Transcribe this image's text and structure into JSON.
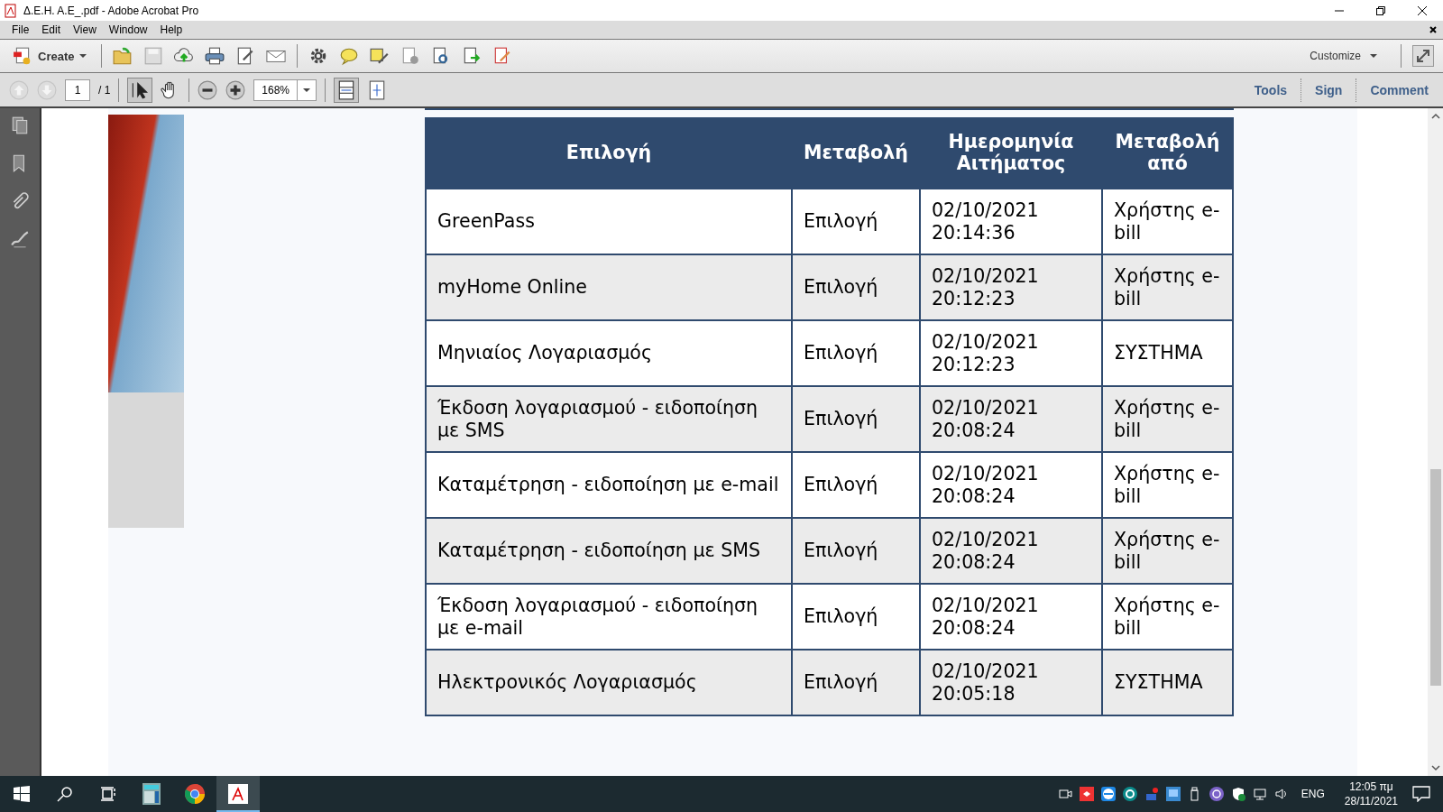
{
  "window": {
    "title": "Δ.Ε.Η. Α.Ε_.pdf - Adobe Acrobat Pro"
  },
  "menu": [
    "File",
    "Edit",
    "View",
    "Window",
    "Help"
  ],
  "toolbar": {
    "create": "Create",
    "customize": "Customize"
  },
  "navigation": {
    "page": "1",
    "page_count": "/ 1",
    "zoom": "168%"
  },
  "panel_tabs": [
    "Tools",
    "Sign",
    "Comment"
  ],
  "table": {
    "columns": [
      "Επιλογή",
      "Μεταβολή",
      "Ημερομηνία Αιτήματος",
      "Μεταβολή από"
    ],
    "rows": [
      [
        "GreenPass",
        "Επιλογή",
        "02/10/2021 20:14:36",
        "Χρήστης e-bill"
      ],
      [
        "myHome Online",
        "Επιλογή",
        "02/10/2021 20:12:23",
        "Χρήστης e-bill"
      ],
      [
        "Μηνιαίος Λογαριασμός",
        "Επιλογή",
        "02/10/2021 20:12:23",
        "ΣΥΣΤΗΜΑ"
      ],
      [
        "Έκδοση λογαριασμού - ειδοποίηση με SMS",
        "Επιλογή",
        "02/10/2021 20:08:24",
        "Χρήστης e-bill"
      ],
      [
        "Καταμέτρηση - ειδοποίηση με e-mail",
        "Επιλογή",
        "02/10/2021 20:08:24",
        "Χρήστης e-bill"
      ],
      [
        "Καταμέτρηση - ειδοποίηση με SMS",
        "Επιλογή",
        "02/10/2021 20:08:24",
        "Χρήστης e-bill"
      ],
      [
        "Έκδοση λογαριασμού - ειδοποίηση με e-mail",
        "Επιλογή",
        "02/10/2021 20:08:24",
        "Χρήστης e-bill"
      ],
      [
        "Ηλεκτρονικός Λογαριασμός",
        "Επιλογή",
        "02/10/2021 20:05:18",
        "ΣΥΣΤΗΜΑ"
      ]
    ]
  },
  "taskbar": {
    "apps": [
      {
        "kind": "calculator",
        "selected": false
      },
      {
        "kind": "browser",
        "selected": false
      },
      {
        "kind": "pdf",
        "selected": true
      }
    ],
    "language": "ENG",
    "time": "12:05 πμ",
    "date": "28/11/2021"
  }
}
